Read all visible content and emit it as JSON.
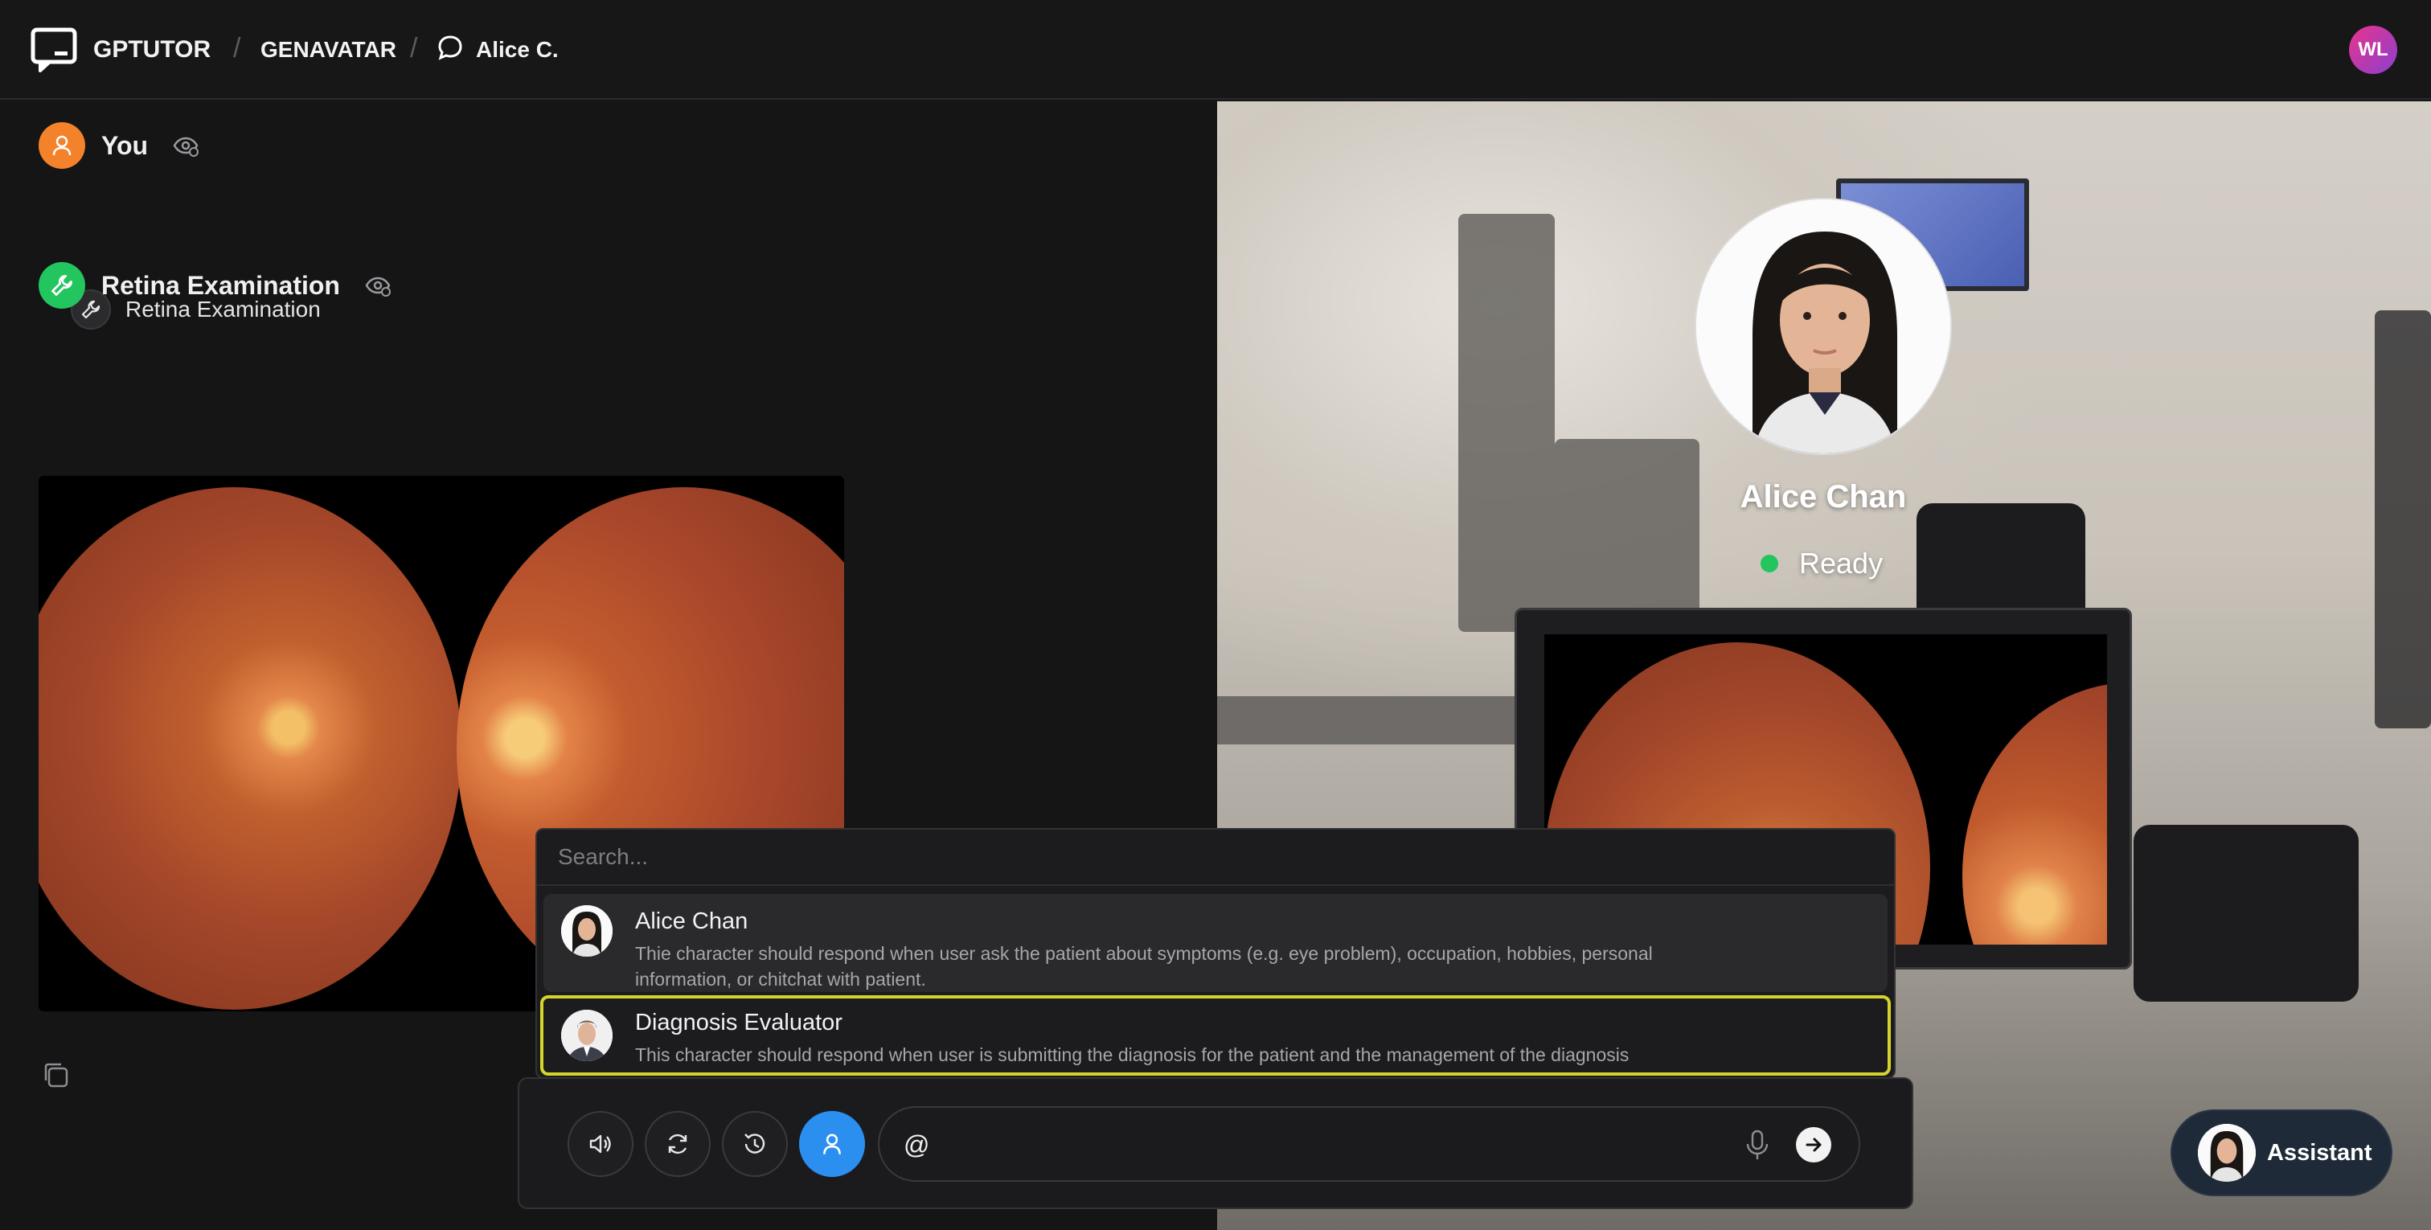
{
  "header": {
    "brand": "GPTUTOR",
    "crumb_project": "GENAVATAR",
    "crumb_chat": "Alice C.",
    "user_initials": "WL"
  },
  "messages": [
    {
      "role": "You",
      "tool_label": "Retina Examination",
      "icon": "user-icon",
      "color": "#f4822b"
    },
    {
      "role": "Retina Examination",
      "icon": "wrench-icon",
      "color": "#22c55e"
    }
  ],
  "character": {
    "name": "Alice Chan",
    "status": "Ready",
    "status_color": "#22c55e"
  },
  "dropdown": {
    "search_placeholder": "Search...",
    "items": [
      {
        "name": "Alice Chan",
        "description_line1": "Thie character should respond when user ask the patient about symptoms (e.g. eye problem), occupation, hobbies, personal",
        "description_line2": "information, or chitchat with patient."
      },
      {
        "name": "Diagnosis Evaluator",
        "description_line1": "This character should respond when user is submitting the diagnosis for the patient and the management of the diagnosis",
        "selected": true,
        "highlight_color": "#d4d42a"
      }
    ]
  },
  "input": {
    "value": "@",
    "controls": [
      "volume-icon",
      "refresh-icon",
      "history-icon",
      "person-icon",
      "mic-icon",
      "send-arrow-icon"
    ],
    "active_color": "#2b8ff0"
  },
  "assistant_button": {
    "label": "Assistant"
  }
}
